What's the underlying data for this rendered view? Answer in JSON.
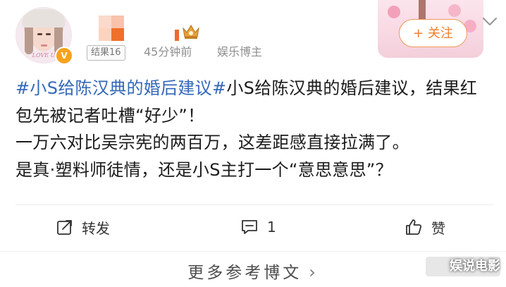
{
  "header": {
    "avatar_caption": "LOVE U",
    "verified_badge": "V",
    "tag_badge": "结果16",
    "time": "45分钟前",
    "source": "娱乐博主",
    "follow_label": "+ 关注"
  },
  "post": {
    "hashtag": "#小S给陈汉典的婚后建议#",
    "body": "小S给陈汉典的婚后建议，结果红包先被记者吐槽“好少”！\n一万六对比吴宗宪的两百万，这差距感直接拉满了。\n是真·塑料师徒情，还是小S主打一个“意思意思”？"
  },
  "actions": {
    "repost_label": "转发",
    "comment_count": "1",
    "like_label": "赞"
  },
  "more": {
    "label": "更多参考博文"
  },
  "watermark": {
    "text": "娱说电影"
  },
  "colors": {
    "hashtag": "#3468b8",
    "follow_accent": "#ef7e2c",
    "verified": "#f7a21c"
  }
}
